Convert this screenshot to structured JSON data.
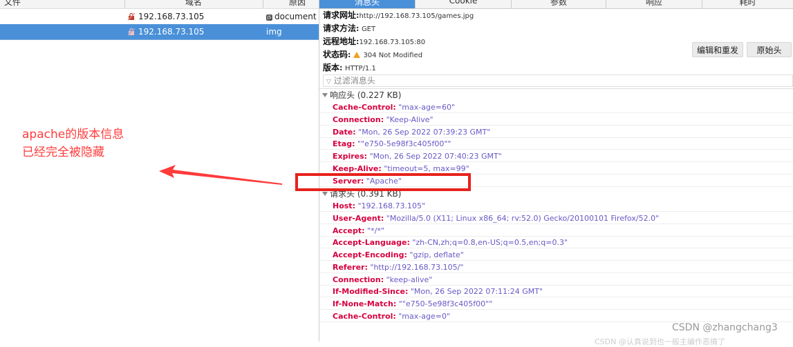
{
  "request_list": {
    "columns": {
      "file": "文件",
      "domain": "域名",
      "cause": "原因"
    },
    "rows": [
      {
        "domain": "192.168.73.105",
        "cause_icon": "JS",
        "cause": "document",
        "selected": false
      },
      {
        "domain": "192.168.73.105",
        "cause": "img",
        "selected": true
      }
    ]
  },
  "annotation": {
    "line1": "apache的版本信息",
    "line2": "已经完全被隐藏",
    "color": "#ff3b3b"
  },
  "tabs": [
    "消息头",
    "Cookie",
    "参数",
    "响应",
    "耗时"
  ],
  "active_tab": "消息头",
  "summary": {
    "url_label": "请求网址:",
    "url": "http://192.168.73.105/games.jpg",
    "method_label": "请求方法:",
    "method": "GET",
    "remote_label": "远程地址:",
    "remote": "192.168.73.105:80",
    "status_label": "状态码:",
    "status": "304 Not Modified",
    "version_label": "版本:",
    "version": "HTTP/1.1"
  },
  "buttons": {
    "edit_resend": "编辑和重发",
    "raw_headers": "原始头"
  },
  "filter": {
    "placeholder": "过滤消息头"
  },
  "response_headers": {
    "title": "响应头 (0.227 KB)",
    "items": [
      {
        "k": "Cache-Control:",
        "v": "\"max-age=60\""
      },
      {
        "k": "Connection:",
        "v": "\"Keep-Alive\""
      },
      {
        "k": "Date:",
        "v": "\"Mon, 26 Sep 2022 07:39:23 GMT\""
      },
      {
        "k": "Etag:",
        "v": "\"\"e750-5e98f3c405f00\"\""
      },
      {
        "k": "Expires:",
        "v": "\"Mon, 26 Sep 2022 07:40:23 GMT\""
      },
      {
        "k": "Keep-Alive:",
        "v": "\"timeout=5, max=99\""
      },
      {
        "k": "Server:",
        "v": "\"Apache\""
      }
    ]
  },
  "request_headers": {
    "title": "请求头 (0.391 KB)",
    "items": [
      {
        "k": "Host:",
        "v": "\"192.168.73.105\""
      },
      {
        "k": "User-Agent:",
        "v": "\"Mozilla/5.0 (X11; Linux x86_64; rv:52.0) Gecko/20100101 Firefox/52.0\""
      },
      {
        "k": "Accept:",
        "v": "\"*/*\""
      },
      {
        "k": "Accept-Language:",
        "v": "\"zh-CN,zh;q=0.8,en-US;q=0.5,en;q=0.3\""
      },
      {
        "k": "Accept-Encoding:",
        "v": "\"gzip, deflate\""
      },
      {
        "k": "Referer:",
        "v": "\"http://192.168.73.105/\""
      },
      {
        "k": "Connection:",
        "v": "\"keep-alive\""
      },
      {
        "k": "If-Modified-Since:",
        "v": "\"Mon, 26 Sep 2022 07:11:24 GMT\""
      },
      {
        "k": "If-None-Match:",
        "v": "\"\"e750-5e98f3c405f00\"\""
      },
      {
        "k": "Cache-Control:",
        "v": "\"max-age=0\""
      }
    ]
  },
  "watermark": "CSDN @zhangchang3",
  "watermark_partial": "CSDN @认真说到也一般主编作恶搞了"
}
